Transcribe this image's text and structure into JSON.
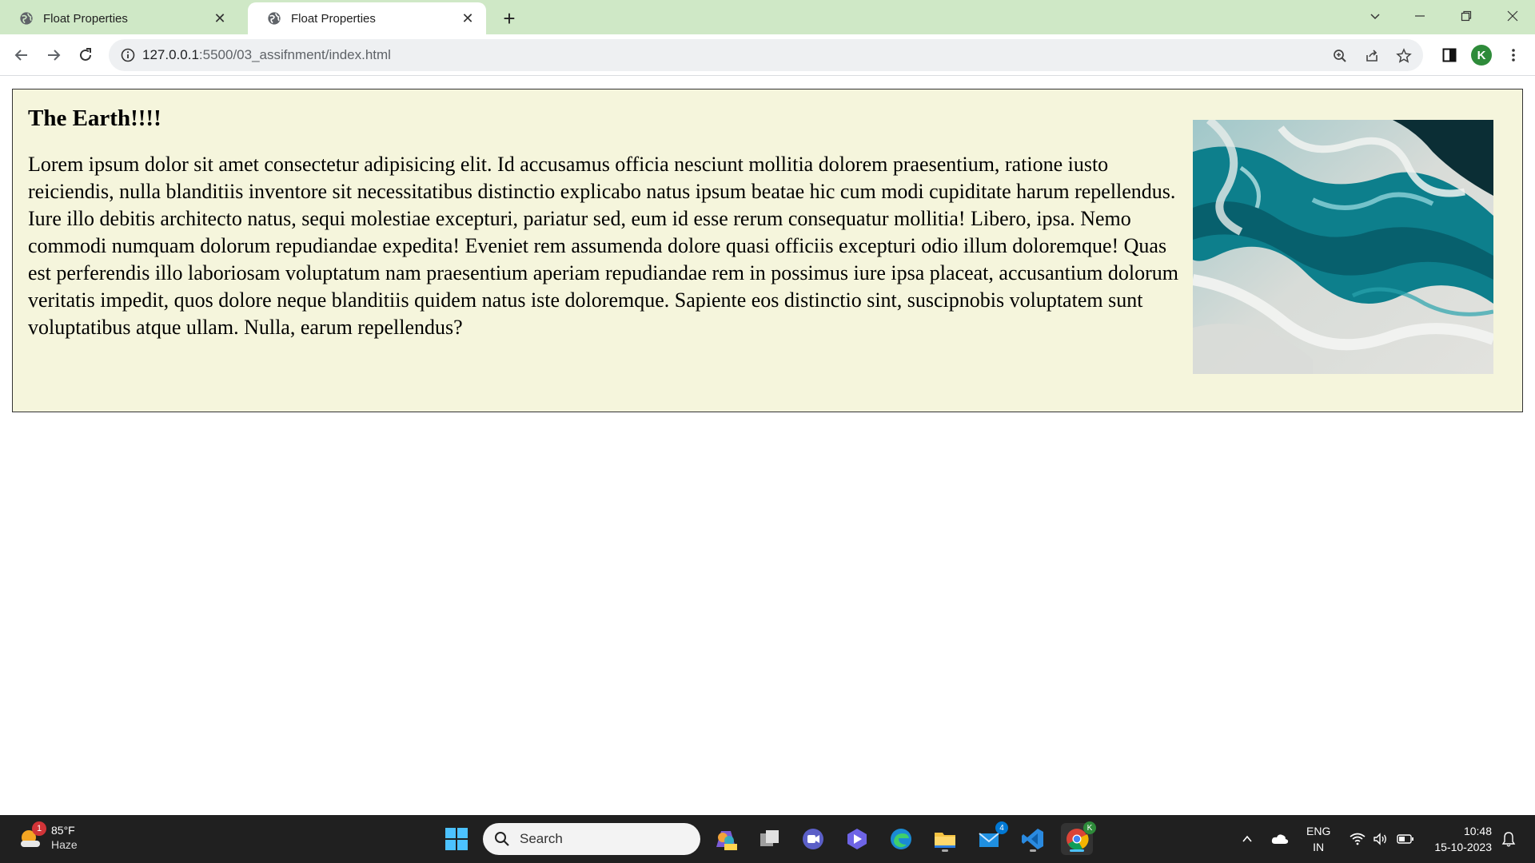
{
  "browser": {
    "tabs": [
      {
        "title": "Float Properties",
        "active": false
      },
      {
        "title": "Float Properties",
        "active": true
      }
    ],
    "url_host": "127.0.0.1",
    "url_path": ":5500/03_assifnment/index.html",
    "profile_initial": "K",
    "profile_color": "#2e8b3a",
    "tabstrip_color": "#cfe8c6"
  },
  "page": {
    "heading": "The Earth!!!!",
    "paragraph": "Lorem ipsum dolor sit amet consectetur adipisicing elit. Id accusamus officia nesciunt mollitia dolorem praesentium, ratione iusto reiciendis, nulla blanditiis inventore sit necessitatibus distinctio explicabo natus ipsum beatae hic cum modi cupiditate harum repellendus. Iure illo debitis architecto natus, sequi molestiae excepturi, pariatur sed, eum id esse rerum consequatur mollitia! Libero, ipsa. Nemo commodi numquam dolorum repudiandae expedita! Eveniet rem assumenda dolore quasi officiis excepturi odio illum doloremque! Quas est perferendis illo laboriosam voluptatum nam praesentium aperiam repudiandae rem in possimus iure ipsa placeat, accusantium dolorum veritatis impedit, quos dolore neque blanditiis quidem natus iste doloremque. Sapiente eos distinctio sint, suscipnobis voluptatem sunt voluptatibus atque ullam. Nulla, earum repellendus?",
    "box_background": "#f5f5dc",
    "image_icon": "teal-marble-image"
  },
  "taskbar": {
    "weather_badge": "1",
    "temperature": "85°F",
    "condition": "Haze",
    "search_label": "Search",
    "mail_badge": "4",
    "chrome_badge": "K",
    "lang_line1": "ENG",
    "lang_line2": "IN",
    "time": "10:48",
    "date": "15-10-2023"
  }
}
